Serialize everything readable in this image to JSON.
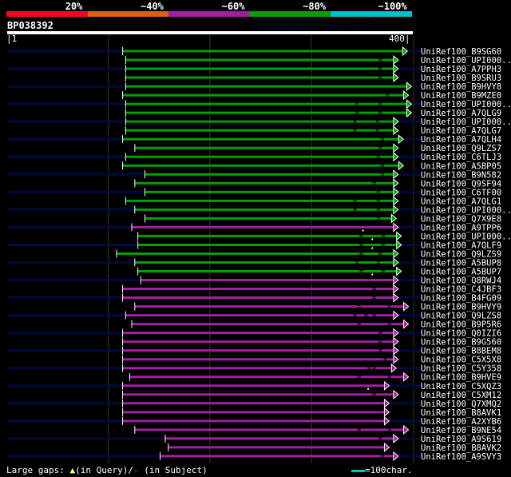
{
  "header": {
    "percent_labels": [
      "20%",
      "~40%",
      "~60%",
      "~80%",
      "~100%"
    ],
    "colors": [
      "#ff0022",
      "#e06000",
      "#a020a0",
      "#00a000",
      "#00c0c8"
    ]
  },
  "query": {
    "name": "BP038392",
    "start_label": "|1",
    "end_label": "400|",
    "length": 400
  },
  "credit": "AlignView.pm Beta rel.7",
  "rows": [
    {
      "label": "UniRef100_B9SG60",
      "start": 114,
      "end": 390,
      "color": "green"
    },
    {
      "label": "UniRef100_UPI000..",
      "start": 117,
      "end": 381,
      "color": "green",
      "sgaps": [
        368
      ]
    },
    {
      "label": "UniRef100_A7PPH3",
      "start": 117,
      "end": 381,
      "color": "green",
      "sgaps": [
        368
      ]
    },
    {
      "label": "UniRef100_B9SRU3",
      "start": 117,
      "end": 381,
      "color": "green",
      "sgaps": [
        368
      ]
    },
    {
      "label": "UniRef100_B9HVY8",
      "start": 117,
      "end": 394,
      "color": "green"
    },
    {
      "label": "UniRef100_B9MZE0",
      "start": 114,
      "end": 391,
      "color": "green",
      "sgaps": [
        375
      ]
    },
    {
      "label": "UniRef100_UPI000..",
      "start": 117,
      "end": 394,
      "color": "green",
      "sgaps": [
        345,
        368
      ]
    },
    {
      "label": "UniRef100_A7QLG9",
      "start": 117,
      "end": 394,
      "color": "green",
      "sgaps": [
        345,
        368
      ]
    },
    {
      "label": "UniRef100_UPI000..",
      "start": 117,
      "end": 381,
      "color": "green",
      "sgaps": [
        343,
        365
      ]
    },
    {
      "label": "UniRef100_A7QLG7",
      "start": 117,
      "end": 381,
      "color": "green",
      "sgaps": [
        343,
        365
      ]
    },
    {
      "label": "UniRef100_A7QLH4",
      "start": 114,
      "end": 386,
      "color": "green",
      "sgaps": [
        370
      ]
    },
    {
      "label": "UniRef100_Q9LZS7",
      "start": 126,
      "end": 381,
      "color": "green",
      "sgaps": [
        368
      ]
    },
    {
      "label": "UniRef100_C6TLJ3",
      "start": 117,
      "end": 381,
      "color": "green",
      "sgaps": [
        366
      ]
    },
    {
      "label": "UniRef100_A5BP05",
      "start": 114,
      "end": 386,
      "color": "green",
      "sgaps": [
        370
      ]
    },
    {
      "label": "UniRef100_B9N582",
      "start": 136,
      "end": 381,
      "color": "green",
      "sgaps": [
        370
      ]
    },
    {
      "label": "UniRef100_Q9SF94",
      "start": 126,
      "end": 381,
      "color": "green",
      "sgaps": [
        362
      ]
    },
    {
      "label": "UniRef100_C6TF00",
      "start": 136,
      "end": 381,
      "color": "green",
      "sgaps": [
        366
      ]
    },
    {
      "label": "UniRef100_A7QLG1",
      "start": 117,
      "end": 381,
      "color": "green",
      "sgaps": [
        343,
        366
      ]
    },
    {
      "label": "UniRef100_UPI000..",
      "start": 126,
      "end": 381,
      "color": "green",
      "sgaps": [
        343,
        366
      ]
    },
    {
      "label": "UniRef100_Q7X9E8",
      "start": 136,
      "end": 379,
      "color": "green",
      "sgaps": [
        366
      ]
    },
    {
      "label": "UniRef100_A9TPP6",
      "start": 123,
      "end": 381,
      "color": "magenta",
      "qgaps": [
        351
      ]
    },
    {
      "label": "UniRef100_UPI000..",
      "start": 129,
      "end": 384,
      "color": "green",
      "sgaps": [
        349,
        371
      ],
      "qgaps": [
        360
      ]
    },
    {
      "label": "UniRef100_A7QLF9",
      "start": 129,
      "end": 384,
      "color": "green",
      "sgaps": [
        349,
        371
      ],
      "qgaps": [
        360
      ]
    },
    {
      "label": "UniRef100_Q9LZS9",
      "start": 108,
      "end": 381,
      "color": "green",
      "sgaps": [
        349,
        368
      ]
    },
    {
      "label": "UniRef100_A5BUP8",
      "start": 126,
      "end": 381,
      "color": "green",
      "sgaps": [
        345,
        366
      ]
    },
    {
      "label": "UniRef100_A5BUP7",
      "start": 129,
      "end": 384,
      "color": "green",
      "sgaps": [
        349,
        371
      ],
      "qgaps": [
        360
      ]
    },
    {
      "label": "UniRef100_Q8RWJ4",
      "start": 132,
      "end": 381,
      "color": "magenta"
    },
    {
      "label": "UniRef100_C4JBF3",
      "start": 114,
      "end": 381,
      "color": "magenta",
      "sgaps": [
        362
      ]
    },
    {
      "label": "UniRef100_B4FG09",
      "start": 114,
      "end": 381,
      "color": "magenta",
      "sgaps": [
        362
      ]
    },
    {
      "label": "UniRef100_B9HVY9",
      "start": 126,
      "end": 391,
      "color": "magenta",
      "sgaps": [
        347,
        377
      ]
    },
    {
      "label": "UniRef100_Q9LZS8",
      "start": 117,
      "end": 381,
      "color": "magenta",
      "sgaps": [
        343,
        354,
        362
      ]
    },
    {
      "label": "UniRef100_B9P5R6",
      "start": 123,
      "end": 391,
      "color": "magenta",
      "sgaps": [
        347,
        377
      ]
    },
    {
      "label": "UniRef100_Q0IZI6",
      "start": 114,
      "end": 381,
      "color": "magenta",
      "sgaps": [
        368
      ]
    },
    {
      "label": "UniRef100_B9G560",
      "start": 114,
      "end": 381,
      "color": "magenta",
      "sgaps": [
        368
      ]
    },
    {
      "label": "UniRef100_B8BEM8",
      "start": 114,
      "end": 381,
      "color": "magenta",
      "sgaps": [
        368
      ]
    },
    {
      "label": "UniRef100_C5X5X8",
      "start": 114,
      "end": 381,
      "color": "magenta",
      "sgaps": [
        373
      ]
    },
    {
      "label": "UniRef100_C5Y358",
      "start": 114,
      "end": 379,
      "color": "magenta",
      "sgaps": [
        357,
        362
      ]
    },
    {
      "label": "UniRef100_B9HVE9",
      "start": 121,
      "end": 391,
      "color": "magenta",
      "sgaps": [
        347,
        377
      ]
    },
    {
      "label": "UniRef100_C5XQZ3",
      "start": 114,
      "end": 372,
      "color": "magenta",
      "qgaps": [
        356
      ]
    },
    {
      "label": "UniRef100_C5XM12",
      "start": 114,
      "end": 381,
      "color": "magenta",
      "sgaps": [
        362
      ]
    },
    {
      "label": "UniRef100_Q7XMQ2",
      "start": 114,
      "end": 372,
      "color": "magenta"
    },
    {
      "label": "UniRef100_B8AVK1",
      "start": 114,
      "end": 372,
      "color": "magenta"
    },
    {
      "label": "UniRef100_A2XYB6",
      "start": 114,
      "end": 372,
      "color": "magenta"
    },
    {
      "label": "UniRef100_B9NE54",
      "start": 126,
      "end": 391,
      "color": "magenta",
      "sgaps": [
        347,
        377
      ]
    },
    {
      "label": "UniRef100_A9S619",
      "start": 156,
      "end": 381,
      "color": "magenta",
      "sgaps": [
        368
      ]
    },
    {
      "label": "UniRef100_B8AVK2",
      "start": 159,
      "end": 372,
      "color": "magenta"
    },
    {
      "label": "UniRef100_A9SVY3",
      "start": 151,
      "end": 381,
      "color": "magenta",
      "sgaps": [
        370
      ]
    }
  ],
  "legend": {
    "prefix": "Large gaps:",
    "query_gap": "(in Query)/",
    "subject_gap": "(in Subject)",
    "scale_key": "=100char."
  }
}
